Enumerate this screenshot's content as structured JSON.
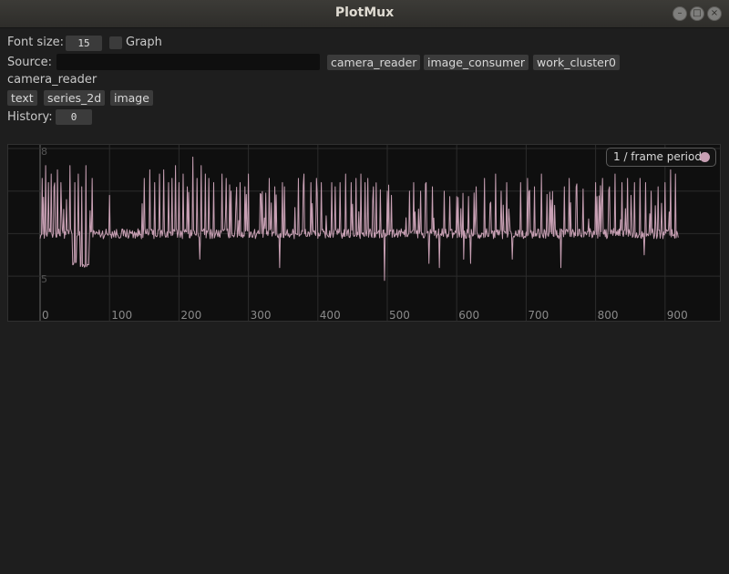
{
  "window": {
    "title": "PlotMux"
  },
  "controls": {
    "font_size_label": "Font size:",
    "font_size_value": "15",
    "graph_label": "Graph",
    "source_label": "Source:",
    "source_value": "",
    "sources": [
      "camera_reader",
      "image_consumer",
      "work_cluster0"
    ],
    "selected_source": "camera_reader",
    "types": [
      "text",
      "series_2d",
      "image"
    ],
    "history_label": "History:",
    "history_value": "0"
  },
  "legend": {
    "label": "1 / frame period",
    "color": "#c8a0b4"
  },
  "chart_data": {
    "type": "line",
    "xlim": [
      0,
      920
    ],
    "ylim": [
      4.7,
      8.1
    ],
    "xticks": [
      "0",
      "100",
      "200",
      "300",
      "400",
      "500",
      "600",
      "700",
      "800",
      "900"
    ],
    "yticks": [
      "8",
      "5"
    ],
    "grid": true,
    "legend_position": "top-right",
    "series": [
      {
        "name": "1 / frame period",
        "color": "#c8a0b4",
        "baseline": 6.0,
        "noise": 0.12,
        "n_points": 920,
        "spikes_up": [
          [
            3,
            7.3
          ],
          [
            8,
            7.6
          ],
          [
            12,
            7.2
          ],
          [
            16,
            7.4
          ],
          [
            20,
            7.1
          ],
          [
            25,
            7.5
          ],
          [
            30,
            7.2
          ],
          [
            34,
            7.3
          ],
          [
            38,
            7.4
          ],
          [
            43,
            7.6
          ],
          [
            50,
            7.2
          ],
          [
            55,
            7.4
          ],
          [
            60,
            7.1
          ],
          [
            66,
            7.6
          ],
          [
            75,
            7.3
          ],
          [
            100,
            6.9
          ],
          [
            150,
            7.3
          ],
          [
            158,
            7.5
          ],
          [
            165,
            7.2
          ],
          [
            172,
            7.4
          ],
          [
            178,
            7.5
          ],
          [
            185,
            7.2
          ],
          [
            190,
            7.3
          ],
          [
            195,
            7.6
          ],
          [
            200,
            7.2
          ],
          [
            206,
            7.4
          ],
          [
            212,
            7.1
          ],
          [
            220,
            7.8
          ],
          [
            226,
            7.3
          ],
          [
            232,
            7.6
          ],
          [
            238,
            7.4
          ],
          [
            243,
            7.3
          ],
          [
            250,
            7.2
          ],
          [
            262,
            7.4
          ],
          [
            268,
            7.3
          ],
          [
            275,
            7.0
          ],
          [
            282,
            7.5
          ],
          [
            288,
            7.2
          ],
          [
            295,
            7.1
          ],
          [
            300,
            7.4
          ],
          [
            318,
            7.2
          ],
          [
            325,
            7.4
          ],
          [
            330,
            7.3
          ],
          [
            338,
            7.1
          ],
          [
            345,
            7.0
          ],
          [
            352,
            7.1
          ],
          [
            372,
            7.3
          ],
          [
            380,
            7.4
          ],
          [
            390,
            7.2
          ],
          [
            398,
            7.3
          ],
          [
            405,
            7.2
          ],
          [
            412,
            7.3
          ],
          [
            420,
            7.2
          ],
          [
            425,
            7.1
          ],
          [
            432,
            7.2
          ],
          [
            440,
            7.4
          ],
          [
            448,
            7.2
          ],
          [
            455,
            7.3
          ],
          [
            462,
            7.4
          ],
          [
            468,
            7.2
          ],
          [
            472,
            7.3
          ],
          [
            480,
            7.1
          ],
          [
            490,
            7.2
          ],
          [
            500,
            7.0
          ],
          [
            506,
            6.9
          ],
          [
            532,
            7.0
          ],
          [
            538,
            7.2
          ],
          [
            548,
            7.0
          ],
          [
            556,
            7.2
          ],
          [
            565,
            7.1
          ],
          [
            575,
            7.3
          ],
          [
            582,
            7.0
          ],
          [
            590,
            7.1
          ],
          [
            600,
            7.3
          ],
          [
            610,
            7.0
          ],
          [
            628,
            7.1
          ],
          [
            640,
            7.3
          ],
          [
            648,
            7.2
          ],
          [
            656,
            7.4
          ],
          [
            664,
            7.0
          ],
          [
            672,
            7.2
          ],
          [
            680,
            7.1
          ],
          [
            692,
            7.2
          ],
          [
            702,
            7.3
          ],
          [
            712,
            7.1
          ],
          [
            722,
            7.4
          ],
          [
            730,
            7.0
          ],
          [
            738,
            7.1
          ],
          [
            755,
            7.1
          ],
          [
            762,
            7.3
          ],
          [
            772,
            7.1
          ],
          [
            782,
            7.3
          ],
          [
            790,
            7.0
          ],
          [
            800,
            7.2
          ],
          [
            810,
            7.3
          ],
          [
            820,
            7.1
          ],
          [
            828,
            7.4
          ],
          [
            838,
            7.2
          ],
          [
            846,
            7.3
          ],
          [
            856,
            7.2
          ],
          [
            864,
            7.3
          ],
          [
            872,
            7.2
          ],
          [
            880,
            7.0
          ],
          [
            890,
            7.1
          ],
          [
            900,
            7.2
          ],
          [
            908,
            7.5
          ],
          [
            915,
            7.4
          ]
        ],
        "spikes_down": [
          [
            230,
            5.4
          ],
          [
            345,
            5.2
          ],
          [
            496,
            4.9
          ],
          [
            502,
            5.1
          ],
          [
            560,
            5.3
          ],
          [
            575,
            5.2
          ],
          [
            610,
            5.4
          ],
          [
            620,
            5.3
          ],
          [
            680,
            5.4
          ],
          [
            750,
            5.2
          ],
          [
            870,
            5.5
          ]
        ],
        "segments_low": [
          [
            47,
            52,
            5.3
          ],
          [
            58,
            70,
            5.25
          ]
        ]
      }
    ]
  }
}
